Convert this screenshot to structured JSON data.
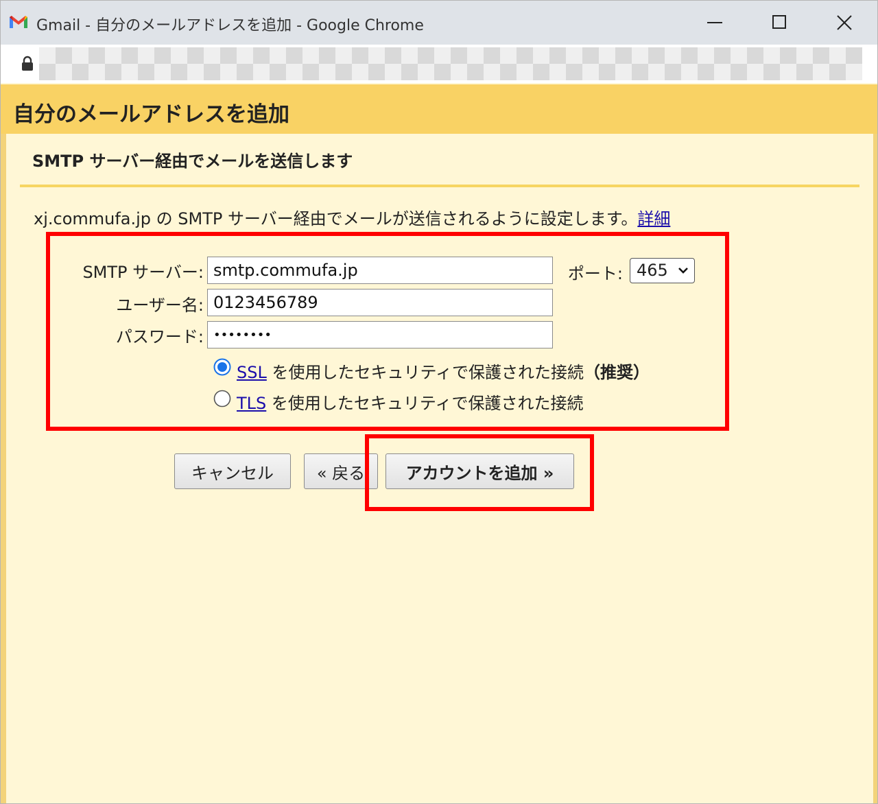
{
  "window": {
    "title": "Gmail - 自分のメールアドレスを追加 - Google Chrome",
    "icon": "gmail-icon",
    "controls": [
      "minimize-icon",
      "maximize-icon",
      "close-icon"
    ]
  },
  "addressbar": {
    "icon": "lock-icon"
  },
  "page": {
    "title": "自分のメールアドレスを追加",
    "section_title": "SMTP サーバー経由でメールを送信します",
    "description": "xj.commufa.jp の SMTP サーバー経由でメールが送信されるように設定します。",
    "details_link": "詳細"
  },
  "form": {
    "smtp_label": "SMTP サーバー:",
    "smtp_value": "smtp.commufa.jp",
    "port_label": "ポート:",
    "port_value": "465",
    "username_label": "ユーザー名:",
    "username_value": "0123456789",
    "password_label": "パスワード:",
    "password_value": "••••••••",
    "ssl_link": "SSL",
    "ssl_text": " を使用したセキュリティで保護された接続",
    "ssl_recommended": "（推奨）",
    "tls_link": "TLS",
    "tls_text": " を使用したセキュリティで保護された接続",
    "selected_security": "SSL"
  },
  "buttons": {
    "cancel": "キャンセル",
    "back": "« 戻る",
    "add_account": "アカウントを追加 »"
  },
  "colors": {
    "header": "#f9d264",
    "background": "#fff7d6",
    "highlight": "#ff0000",
    "link": "#1a0dab"
  }
}
